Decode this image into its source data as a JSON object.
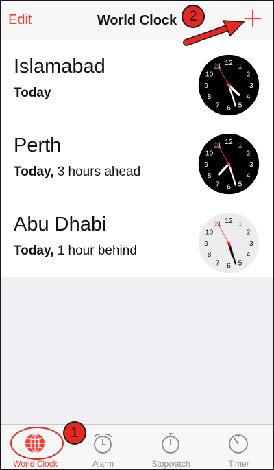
{
  "navbar": {
    "edit_label": "Edit",
    "title": "World Clock",
    "add_icon": "plus-icon"
  },
  "clocks": [
    {
      "city": "Islamabad",
      "day": "Today",
      "offset": "",
      "time": "4:27",
      "face": "dark"
    },
    {
      "city": "Perth",
      "day": "Today,",
      "offset": "3 hours ahead",
      "time": "7:27",
      "face": "dark"
    },
    {
      "city": "Abu Dhabi",
      "day": "Today,",
      "offset": "1 hour behind",
      "time": "5:27",
      "face": "light"
    }
  ],
  "tabbar": {
    "tabs": [
      {
        "label": "World Clock",
        "icon": "globe-icon",
        "active": true
      },
      {
        "label": "Alarm",
        "icon": "alarm-clock-icon",
        "active": false
      },
      {
        "label": "Stopwatch",
        "icon": "stopwatch-icon",
        "active": false
      },
      {
        "label": "Timer",
        "icon": "timer-icon",
        "active": false
      }
    ]
  },
  "annotations": {
    "step1": "1",
    "step2": "2"
  },
  "colors": {
    "accent": "#ff3b30",
    "annotation": "#e8281e",
    "inactive_tab": "#929292"
  }
}
